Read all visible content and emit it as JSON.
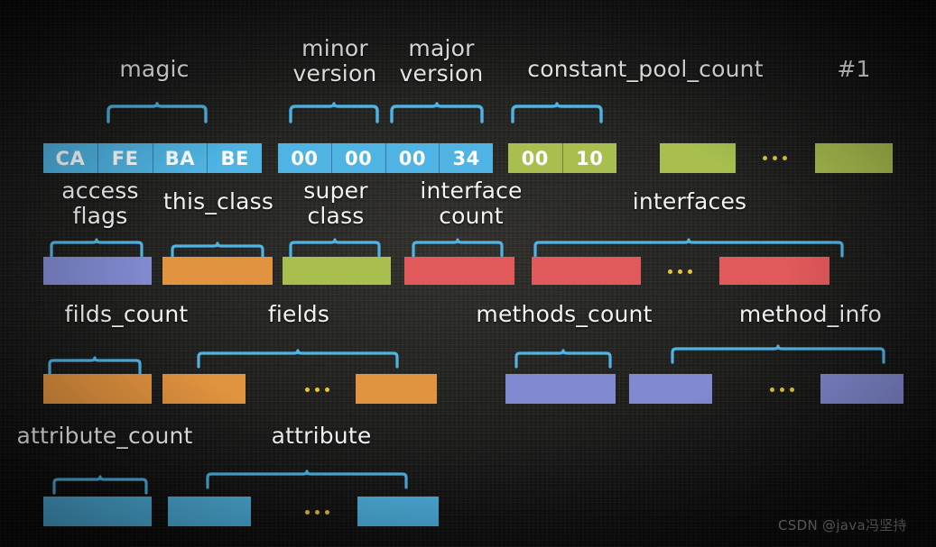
{
  "diagram": {
    "title_text": "Java class file structure byte layout",
    "watermark": "CSDN @java冯坚持",
    "colors": {
      "blue": "#4fb4e3",
      "olive": "#a8bf4f",
      "purple": "#8189d0",
      "orange": "#e2933f",
      "red": "#e2595b",
      "brace": "#4fb4e3",
      "ellipsis_dot": "#e8c63a",
      "label_text": "#f4f4f4",
      "background": "#232321"
    },
    "labels": [
      {
        "id": "magic",
        "text": "magic"
      },
      {
        "id": "minor-version",
        "text": "minor\nversion"
      },
      {
        "id": "major-version",
        "text": "major\nversion"
      },
      {
        "id": "constant-pool-count",
        "text": "constant_pool_count"
      },
      {
        "id": "hash-1",
        "text": "#1"
      },
      {
        "id": "access-flags",
        "text": "access\nflags"
      },
      {
        "id": "this-class",
        "text": "this_class"
      },
      {
        "id": "super-class",
        "text": "super\nclass"
      },
      {
        "id": "interface-count",
        "text": "interface\ncount"
      },
      {
        "id": "interfaces",
        "text": "interfaces"
      },
      {
        "id": "filds-count",
        "text": "filds_count"
      },
      {
        "id": "fields",
        "text": "fields"
      },
      {
        "id": "methods-count",
        "text": "methods_count"
      },
      {
        "id": "method-info",
        "text": "method_info"
      },
      {
        "id": "attribute-count",
        "text": "attribute_count"
      },
      {
        "id": "attribute",
        "text": "attribute"
      }
    ],
    "rows": [
      {
        "id": "row-1",
        "blocks": [
          {
            "id": "magic-bytes",
            "color": "blue",
            "cells": [
              "CA",
              "FE",
              "BA",
              "BE"
            ]
          },
          {
            "id": "version-bytes",
            "color": "blue",
            "cells": [
              "00",
              "00",
              "00",
              "34"
            ]
          },
          {
            "id": "constant-pool-count-bytes",
            "color": "olive",
            "cells": [
              "00",
              "10"
            ]
          },
          {
            "id": "constant-pool-entry-1",
            "color": "olive",
            "cells": [
              "",
              ""
            ]
          },
          {
            "id": "constant-pool-entry-n",
            "color": "olive",
            "cells": [
              "",
              ""
            ]
          }
        ]
      },
      {
        "id": "row-2",
        "blocks": [
          {
            "id": "access-flags-bytes",
            "color": "purple",
            "cells": [
              "",
              ""
            ]
          },
          {
            "id": "this-class-bytes",
            "color": "orange",
            "cells": [
              "",
              ""
            ]
          },
          {
            "id": "super-class-bytes",
            "color": "olive",
            "cells": [
              "",
              ""
            ]
          },
          {
            "id": "interface-count-bytes",
            "color": "red",
            "cells": [
              "",
              ""
            ]
          },
          {
            "id": "interface-entry-1",
            "color": "red",
            "cells": [
              "",
              ""
            ]
          },
          {
            "id": "interface-entry-n",
            "color": "red",
            "cells": [
              "",
              ""
            ]
          }
        ]
      },
      {
        "id": "row-3",
        "blocks": [
          {
            "id": "fields-count-bytes",
            "color": "orange",
            "cells": [
              "",
              ""
            ]
          },
          {
            "id": "field-entry-1",
            "color": "orange",
            "cells": [
              ""
            ]
          },
          {
            "id": "field-entry-n",
            "color": "orange",
            "cells": [
              ""
            ]
          },
          {
            "id": "methods-count-bytes",
            "color": "purple",
            "cells": [
              "",
              ""
            ]
          },
          {
            "id": "method-entry-1",
            "color": "purple",
            "cells": [
              ""
            ]
          },
          {
            "id": "method-entry-n",
            "color": "purple",
            "cells": [
              ""
            ]
          }
        ]
      },
      {
        "id": "row-4",
        "blocks": [
          {
            "id": "attribute-count-bytes",
            "color": "blue",
            "cells": [
              "",
              ""
            ]
          },
          {
            "id": "attribute-entry-1",
            "color": "blue",
            "cells": [
              ""
            ]
          },
          {
            "id": "attribute-entry-n",
            "color": "blue",
            "cells": [
              ""
            ]
          }
        ]
      }
    ]
  }
}
